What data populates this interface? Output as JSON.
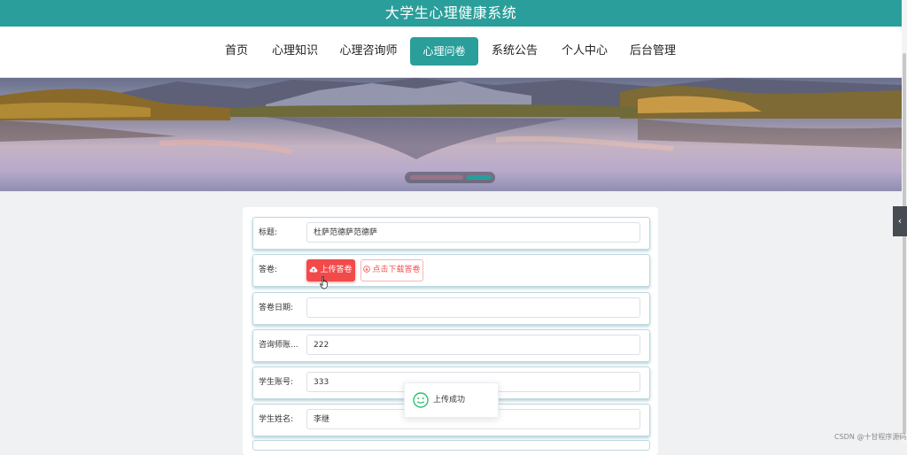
{
  "header": {
    "title": "大学生心理健康系统"
  },
  "nav": {
    "items": [
      {
        "label": "首页"
      },
      {
        "label": "心理知识"
      },
      {
        "label": "心理咨询师"
      },
      {
        "label": "心理问卷",
        "active": true
      },
      {
        "label": "系统公告"
      },
      {
        "label": "个人中心"
      },
      {
        "label": "后台管理"
      }
    ]
  },
  "banner": {
    "slides": 2,
    "active_slide": 2
  },
  "form": {
    "title_label": "标题:",
    "title_value": "杜萨范德萨范德萨",
    "answer_label": "答卷:",
    "upload_button": "上传答卷",
    "download_button": "点击下载答卷",
    "date_label": "答卷日期:",
    "date_value": "",
    "counselor_label": "咨询师账...",
    "counselor_value": "222",
    "student_id_label": "学生账号:",
    "student_id_value": "333",
    "student_name_label": "学生姓名:",
    "student_name_value": "李继"
  },
  "toast": {
    "message": "上传成功",
    "icon": "smile-icon"
  },
  "side_tab": {
    "icon": "chevron-left-icon"
  },
  "watermark": "CSDN @十甘程序源码",
  "colors": {
    "primary": "#2a9e9a",
    "danger": "#f24a4a",
    "success": "#2fbf6f"
  }
}
